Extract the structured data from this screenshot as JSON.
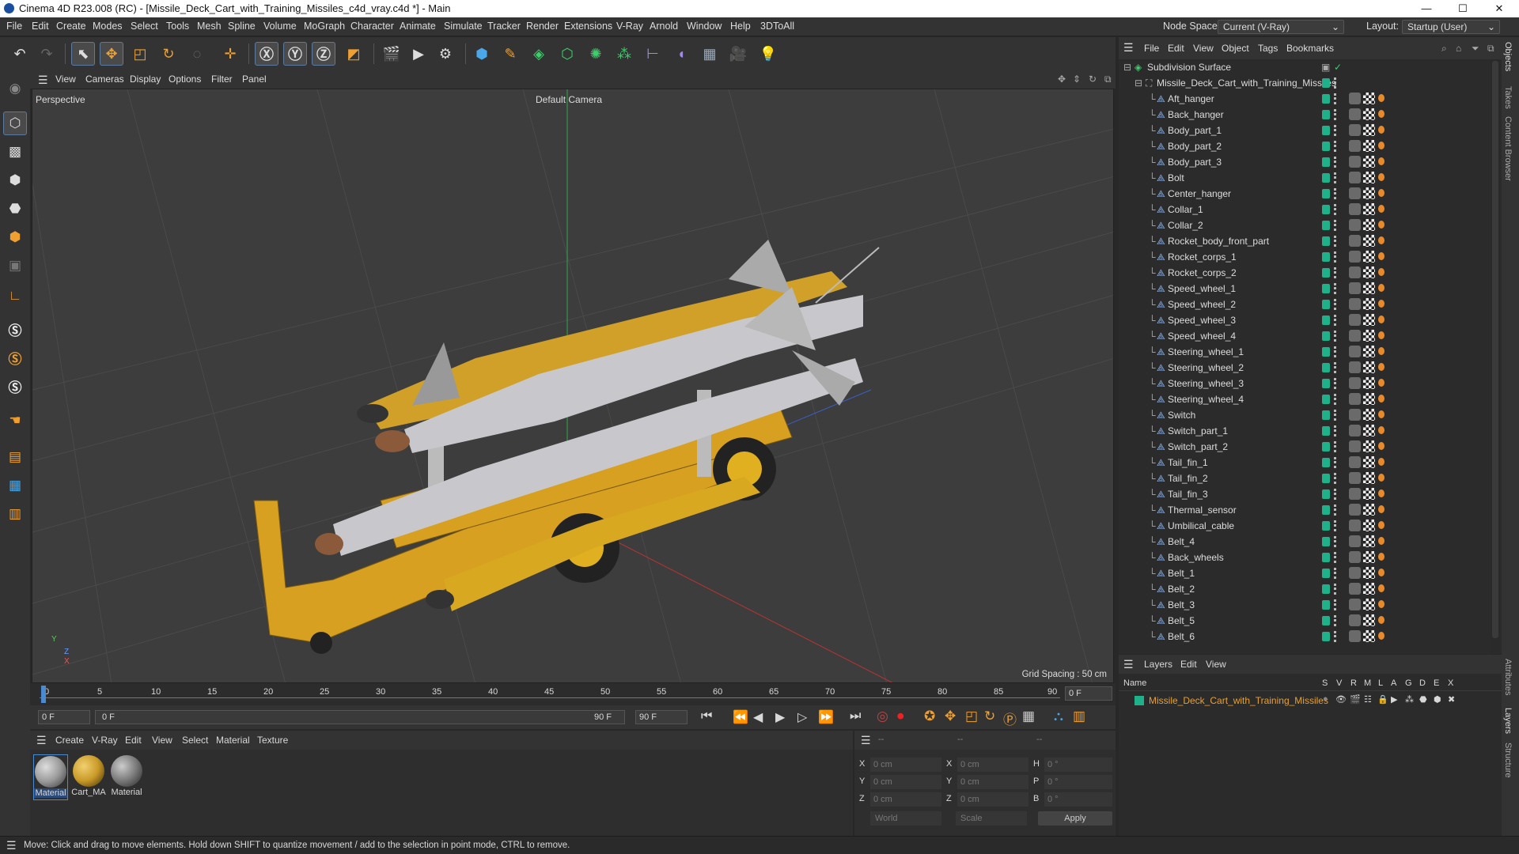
{
  "app": {
    "title": "Cinema 4D R23.008 (RC) - [Missile_Deck_Cart_with_Training_Missiles_c4d_vray.c4d *] - Main",
    "window_controls": [
      "—",
      "☐",
      "✕"
    ]
  },
  "menubar": {
    "items": [
      "File",
      "Edit",
      "Create",
      "Modes",
      "Select",
      "Tools",
      "Mesh",
      "Spline",
      "Volume",
      "MoGraph",
      "Character",
      "Animate",
      "Simulate",
      "Tracker",
      "Render",
      "Extensions",
      "V-Ray",
      "Arnold",
      "Window",
      "Help",
      "3DToAll"
    ],
    "node_space_label": "Node Space:",
    "node_space_value": "Current (V-Ray)",
    "layout_label": "Layout:",
    "layout_value": "Startup (User)"
  },
  "viewport": {
    "menu": [
      "View",
      "Cameras",
      "Display",
      "Options",
      "Filter",
      "Panel"
    ],
    "view_name": "Perspective",
    "camera": "Default Camera",
    "grid_spacing": "Grid Spacing : 50 cm",
    "axis_labels": [
      "Y",
      "Z",
      "X"
    ]
  },
  "timeline": {
    "ticks": [
      "0",
      "5",
      "10",
      "15",
      "20",
      "25",
      "30",
      "35",
      "40",
      "45",
      "50",
      "55",
      "60",
      "65",
      "70",
      "75",
      "80",
      "85",
      "90"
    ],
    "current_frame": "0 F",
    "start": "0 F",
    "range_start": "0 F",
    "range_end": "90 F",
    "end": "90 F"
  },
  "materials": {
    "menu": [
      "Create",
      "V-Ray",
      "Edit",
      "View",
      "Select",
      "Material",
      "Texture"
    ],
    "items": [
      {
        "label": "Material",
        "color": "#9a9a9a"
      },
      {
        "label": "Cart_MA",
        "color": "#c99a28"
      },
      {
        "label": "Material",
        "color": "#7a7a7a"
      }
    ]
  },
  "coords": {
    "header": [
      "--",
      "--",
      "--"
    ],
    "rows": [
      {
        "a": "X",
        "av": "0 cm",
        "b": "X",
        "bv": "0 cm",
        "c": "H",
        "cv": "0 °"
      },
      {
        "a": "Y",
        "av": "0 cm",
        "b": "Y",
        "bv": "0 cm",
        "c": "P",
        "cv": "0 °"
      },
      {
        "a": "Z",
        "av": "0 cm",
        "b": "Z",
        "bv": "0 cm",
        "c": "B",
        "cv": "0 °"
      }
    ],
    "mode1": "World",
    "mode2": "Scale",
    "apply": "Apply"
  },
  "status": "Move: Click and drag to move elements. Hold down SHIFT to quantize movement / add to the selection in point mode, CTRL to remove.",
  "objects": {
    "menu": [
      "File",
      "Edit",
      "View",
      "Object",
      "Tags",
      "Bookmarks"
    ],
    "root": "Subdivision Surface",
    "group": "Missile_Deck_Cart_with_Training_Missiles",
    "items": [
      "Aft_hanger",
      "Back_hanger",
      "Body_part_1",
      "Body_part_2",
      "Body_part_3",
      "Bolt",
      "Center_hanger",
      "Collar_1",
      "Collar_2",
      "Rocket_body_front_part",
      "Rocket_corps_1",
      "Rocket_corps_2",
      "Speed_wheel_1",
      "Speed_wheel_2",
      "Speed_wheel_3",
      "Speed_wheel_4",
      "Steering_wheel_1",
      "Steering_wheel_2",
      "Steering_wheel_3",
      "Steering_wheel_4",
      "Switch",
      "Switch_part_1",
      "Switch_part_2",
      "Tail_fin_1",
      "Tail_fin_2",
      "Tail_fin_3",
      "Thermal_sensor",
      "Umbilical_cable",
      "Belt_4",
      "Back_wheels",
      "Belt_1",
      "Belt_2",
      "Belt_3",
      "Belt_5",
      "Belt_6"
    ]
  },
  "layers": {
    "menu": [
      "Layers",
      "Edit",
      "View"
    ],
    "columns": [
      "Name",
      "S",
      "V",
      "R",
      "M",
      "L",
      "A",
      "G",
      "D",
      "E",
      "X"
    ],
    "layer_name": "Missile_Deck_Cart_with_Training_Missiles"
  },
  "side_tabs": [
    "Objects",
    "Takes",
    "Content Browser",
    "Attributes",
    "Layers",
    "Structure"
  ]
}
